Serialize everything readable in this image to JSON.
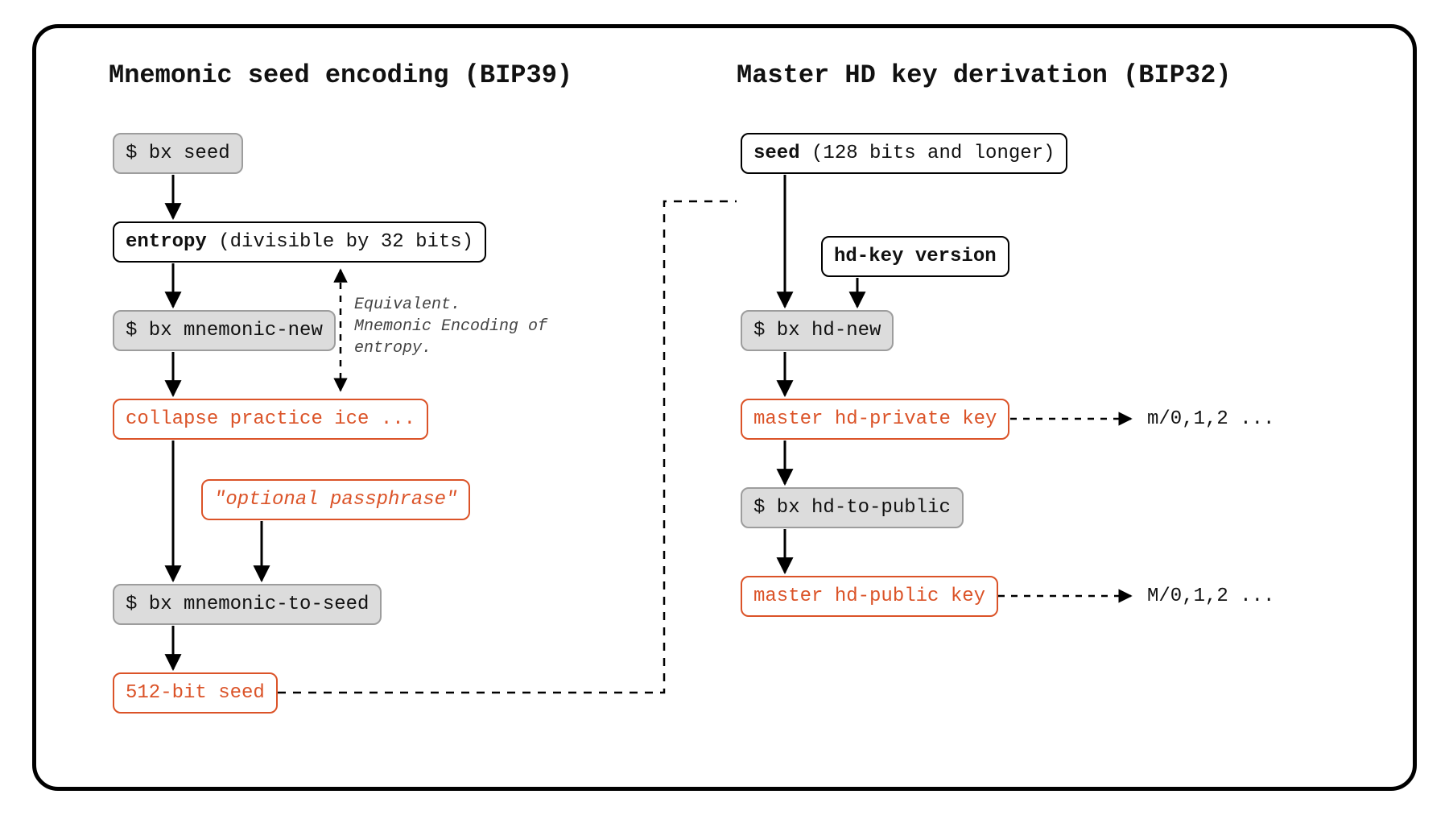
{
  "titles": {
    "left": "Mnemonic seed encoding (BIP39)",
    "right": "Master HD key derivation (BIP32)"
  },
  "left": {
    "bx_seed": "$ bx seed",
    "entropy_bold": "entropy",
    "entropy_rest": " (divisible by 32 bits)",
    "bx_mnemonic_new": "$ bx mnemonic-new",
    "mnemonic_words": "collapse practice ice ...",
    "optional_passphrase": "\"optional passphrase\"",
    "bx_mnemonic_to_seed": "$ bx mnemonic-to-seed",
    "seed_512": "512-bit seed",
    "note": "Equivalent.\nMnemonic Encoding of\nentropy."
  },
  "right": {
    "seed_bold": "seed",
    "seed_rest": " (128 bits and longer)",
    "hd_key_version": "hd-key version",
    "bx_hd_new": "$ bx hd-new",
    "master_priv": "master hd-private key",
    "bx_hd_to_public": "$ bx hd-to-public",
    "master_pub": "master hd-public key",
    "path_priv": "m/0,1,2 ...",
    "path_pub": "M/0,1,2 ..."
  },
  "colors": {
    "orange": "#db5328",
    "gray_fill": "#dcdcdc",
    "gray_border": "#9d9d9d",
    "black": "#000000"
  }
}
